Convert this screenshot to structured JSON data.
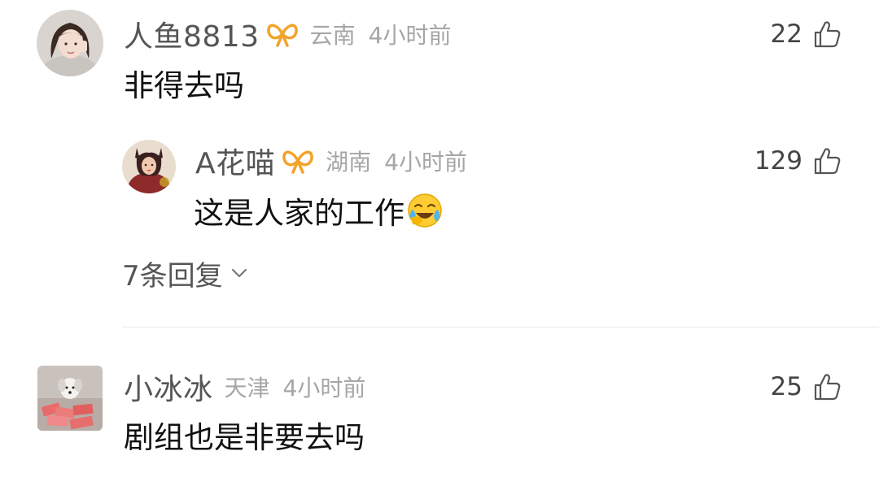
{
  "colors": {
    "username": "#555555",
    "meta": "#a6a6a6",
    "text": "#111111",
    "badge": "#f2a32a",
    "divider": "#e8e8e8"
  },
  "comments": [
    {
      "username": "人鱼8813",
      "has_badge": true,
      "location": "云南",
      "time": "4小时前",
      "likes": "22",
      "text": "非得去吗",
      "avatar_icon": "avatar-girl-photo",
      "reply": {
        "username": "A花喵",
        "has_badge": true,
        "location": "湖南",
        "time": "4小时前",
        "likes": "129",
        "text": "这是人家的工作",
        "emoji": "crying-laughing-face-emoji",
        "avatar_icon": "avatar-cartoon-photo"
      },
      "more_replies": "7条回复",
      "more_replies_icon": "chevron-down-icon"
    },
    {
      "username": "小冰冰",
      "has_badge": false,
      "location": "天津",
      "time": "4小时前",
      "likes": "25",
      "text": "剧组也是非要去吗",
      "avatar_icon": "avatar-dog-money-photo"
    }
  ]
}
